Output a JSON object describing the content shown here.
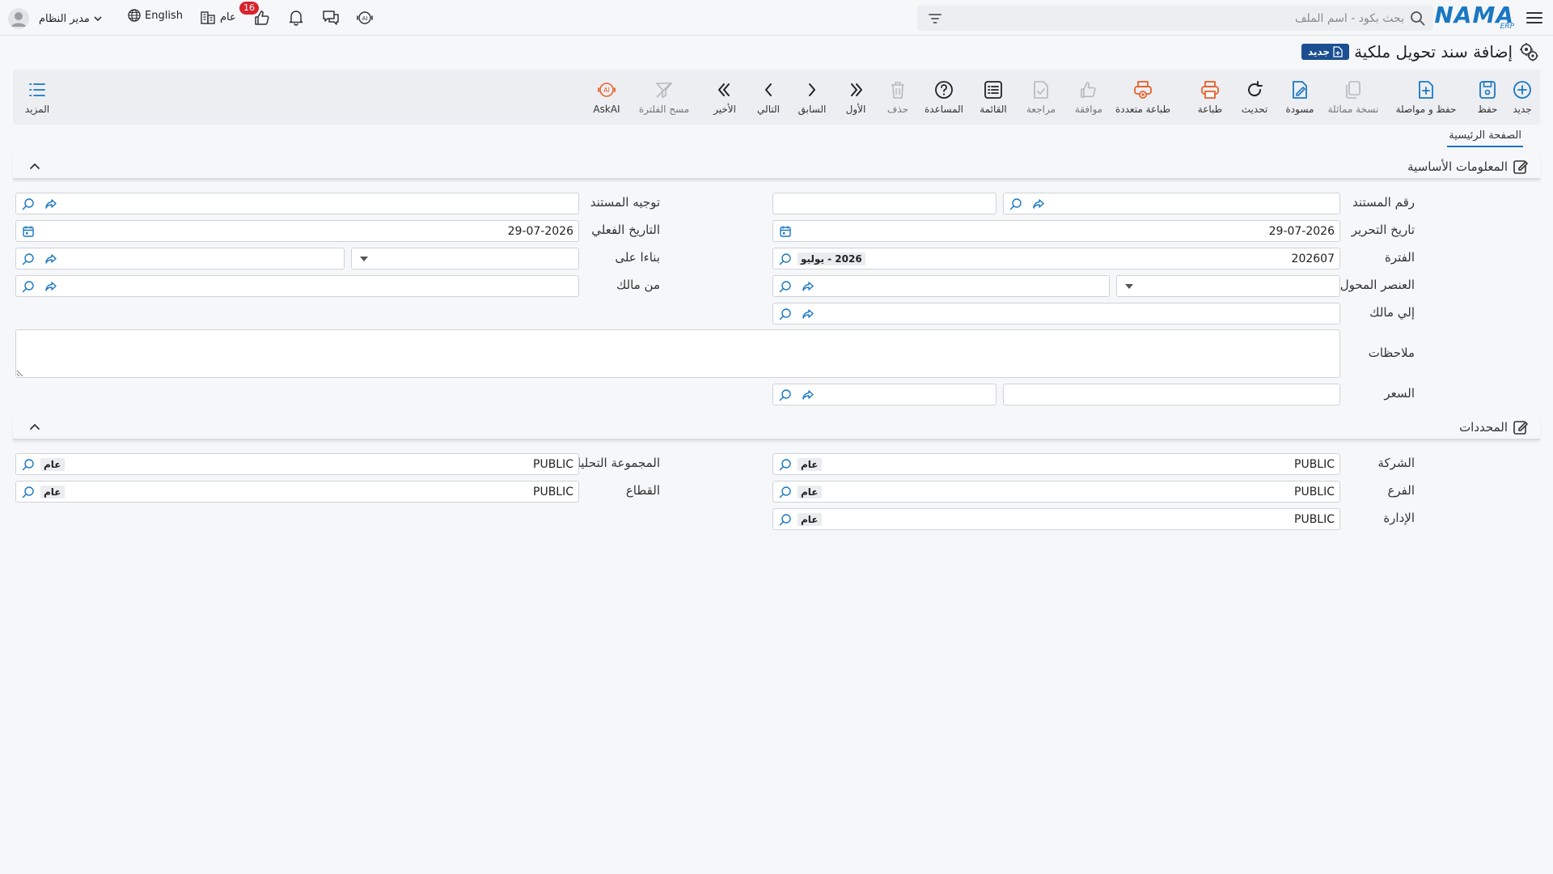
{
  "header": {
    "logo_main": "NAMA",
    "logo_sub": "ERP",
    "search_placeholder": "بحث بكود - اسم الملف",
    "language": "English",
    "general_label": "عام",
    "notification_count": "16",
    "user_name": "مدير النظام"
  },
  "page": {
    "title": "إضافة سند تحويل ملكية",
    "status_badge": "جديد"
  },
  "toolbar": {
    "buttons": [
      {
        "label": "جديد",
        "icon": "add-circle-icon"
      },
      {
        "label": "حفظ",
        "icon": "save-icon"
      },
      {
        "label": "حفظ و مواصلة",
        "icon": "save-continue-icon"
      },
      {
        "label": "نسخة مماثلة",
        "icon": "copy-icon"
      },
      {
        "label": "مسودة",
        "icon": "draft-icon"
      },
      {
        "label": "تحديث",
        "icon": "refresh-icon"
      },
      {
        "label": "طباعة",
        "icon": "print-icon"
      },
      {
        "label": "طباعة متعددة",
        "icon": "multi-print-icon"
      },
      {
        "label": "موافقة",
        "icon": "approve-icon"
      },
      {
        "label": "مراجعة",
        "icon": "review-icon"
      },
      {
        "label": "القائمة",
        "icon": "list-icon"
      },
      {
        "label": "المساعدة",
        "icon": "help-icon"
      },
      {
        "label": "حذف",
        "icon": "delete-icon"
      },
      {
        "label": "الأول",
        "icon": "first-icon"
      },
      {
        "label": "السابق",
        "icon": "previous-icon"
      },
      {
        "label": "التالي",
        "icon": "next-icon"
      },
      {
        "label": "الأخير",
        "icon": "last-icon"
      },
      {
        "label": "مسح الفلترة",
        "icon": "clear-filter-icon"
      },
      {
        "label": "AskAI",
        "icon": "ask-ai-icon"
      }
    ],
    "more_label": "المزيد"
  },
  "tabs": {
    "main": "الصفحة الرئيسية"
  },
  "basic_info": {
    "title": "المعلومات الأساسية",
    "doc_number_label": "رقم المستند",
    "doc_number_value": "",
    "doc_direction_label": "توجيه المستند",
    "doc_direction_value": "",
    "edit_date_label": "تاريخ التحرير",
    "edit_date_value": "29-07-2026",
    "actual_date_label": "التاريخ الفعلي",
    "actual_date_value": "29-07-2026",
    "period_label": "الفترة",
    "period_code": "202607",
    "period_name": "2026 - يوليو",
    "based_on_label": "بناءا على",
    "transferred_item_label": "العنصر المحول",
    "from_owner_label": "من مالك",
    "to_owner_label": "إلي مالك",
    "notes_label": "ملاحظات",
    "price_label": "السعر"
  },
  "determinants": {
    "title": "المحددات",
    "company_label": "الشركة",
    "branch_label": "الفرع",
    "department_label": "الإدارة",
    "analytic_group_label": "المجموعة التحليلية",
    "sector_label": "القطاع",
    "code_value": "PUBLIC",
    "name_value": "عام"
  },
  "colors": {
    "brand_blue": "#1a78c2",
    "badge_navy": "#1b4f91",
    "notification_red": "#d9232e",
    "print_orange": "#e8612c"
  }
}
